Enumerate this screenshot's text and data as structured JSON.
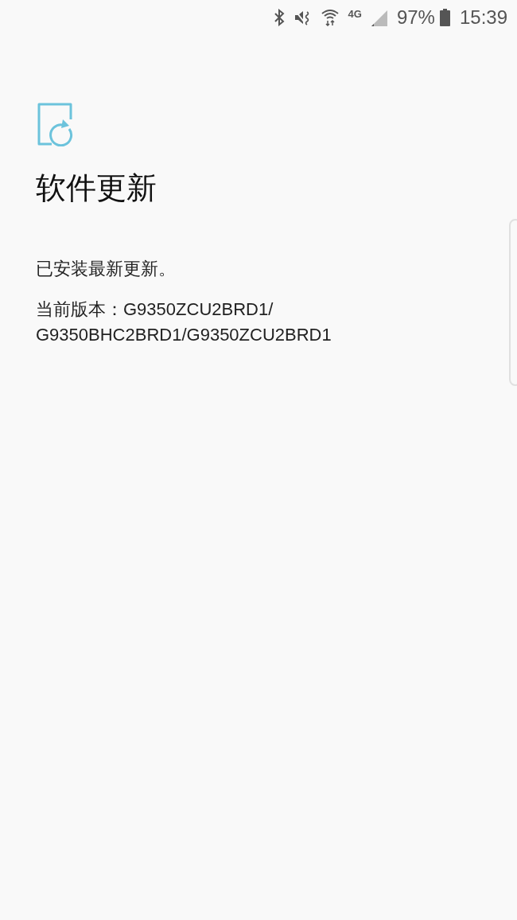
{
  "status_bar": {
    "network": "4G",
    "battery": "97%",
    "time": "15:39"
  },
  "title": "软件更新",
  "message": "已安装最新更新。",
  "version": "当前版本：G9350ZCU2BRD1/G9350BHC2BRD1/G9350ZCU2BRD1"
}
